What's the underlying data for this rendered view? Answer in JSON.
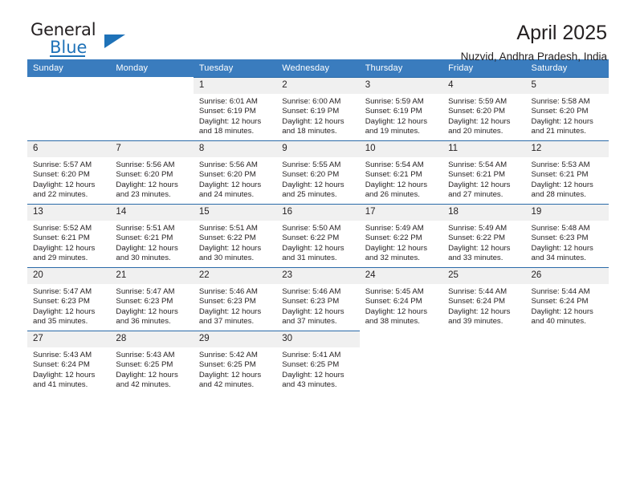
{
  "logo": {
    "primary_text": "General",
    "secondary_text": "Blue",
    "accent_color": "#1f72b8"
  },
  "header": {
    "title": "April 2025",
    "subtitle": "Nuzvid, Andhra Pradesh, India"
  },
  "calendar": {
    "header_color": "#3a7cbe",
    "weekday_headers": [
      "Sunday",
      "Monday",
      "Tuesday",
      "Wednesday",
      "Thursday",
      "Friday",
      "Saturday"
    ],
    "weeks": [
      [
        {
          "day": "",
          "sunrise": "",
          "sunset": "",
          "daylight_line1": "",
          "daylight_line2": ""
        },
        {
          "day": "",
          "sunrise": "",
          "sunset": "",
          "daylight_line1": "",
          "daylight_line2": ""
        },
        {
          "day": "1",
          "sunrise": "Sunrise: 6:01 AM",
          "sunset": "Sunset: 6:19 PM",
          "daylight_line1": "Daylight: 12 hours",
          "daylight_line2": "and 18 minutes."
        },
        {
          "day": "2",
          "sunrise": "Sunrise: 6:00 AM",
          "sunset": "Sunset: 6:19 PM",
          "daylight_line1": "Daylight: 12 hours",
          "daylight_line2": "and 18 minutes."
        },
        {
          "day": "3",
          "sunrise": "Sunrise: 5:59 AM",
          "sunset": "Sunset: 6:19 PM",
          "daylight_line1": "Daylight: 12 hours",
          "daylight_line2": "and 19 minutes."
        },
        {
          "day": "4",
          "sunrise": "Sunrise: 5:59 AM",
          "sunset": "Sunset: 6:20 PM",
          "daylight_line1": "Daylight: 12 hours",
          "daylight_line2": "and 20 minutes."
        },
        {
          "day": "5",
          "sunrise": "Sunrise: 5:58 AM",
          "sunset": "Sunset: 6:20 PM",
          "daylight_line1": "Daylight: 12 hours",
          "daylight_line2": "and 21 minutes."
        }
      ],
      [
        {
          "day": "6",
          "sunrise": "Sunrise: 5:57 AM",
          "sunset": "Sunset: 6:20 PM",
          "daylight_line1": "Daylight: 12 hours",
          "daylight_line2": "and 22 minutes."
        },
        {
          "day": "7",
          "sunrise": "Sunrise: 5:56 AM",
          "sunset": "Sunset: 6:20 PM",
          "daylight_line1": "Daylight: 12 hours",
          "daylight_line2": "and 23 minutes."
        },
        {
          "day": "8",
          "sunrise": "Sunrise: 5:56 AM",
          "sunset": "Sunset: 6:20 PM",
          "daylight_line1": "Daylight: 12 hours",
          "daylight_line2": "and 24 minutes."
        },
        {
          "day": "9",
          "sunrise": "Sunrise: 5:55 AM",
          "sunset": "Sunset: 6:20 PM",
          "daylight_line1": "Daylight: 12 hours",
          "daylight_line2": "and 25 minutes."
        },
        {
          "day": "10",
          "sunrise": "Sunrise: 5:54 AM",
          "sunset": "Sunset: 6:21 PM",
          "daylight_line1": "Daylight: 12 hours",
          "daylight_line2": "and 26 minutes."
        },
        {
          "day": "11",
          "sunrise": "Sunrise: 5:54 AM",
          "sunset": "Sunset: 6:21 PM",
          "daylight_line1": "Daylight: 12 hours",
          "daylight_line2": "and 27 minutes."
        },
        {
          "day": "12",
          "sunrise": "Sunrise: 5:53 AM",
          "sunset": "Sunset: 6:21 PM",
          "daylight_line1": "Daylight: 12 hours",
          "daylight_line2": "and 28 minutes."
        }
      ],
      [
        {
          "day": "13",
          "sunrise": "Sunrise: 5:52 AM",
          "sunset": "Sunset: 6:21 PM",
          "daylight_line1": "Daylight: 12 hours",
          "daylight_line2": "and 29 minutes."
        },
        {
          "day": "14",
          "sunrise": "Sunrise: 5:51 AM",
          "sunset": "Sunset: 6:21 PM",
          "daylight_line1": "Daylight: 12 hours",
          "daylight_line2": "and 30 minutes."
        },
        {
          "day": "15",
          "sunrise": "Sunrise: 5:51 AM",
          "sunset": "Sunset: 6:22 PM",
          "daylight_line1": "Daylight: 12 hours",
          "daylight_line2": "and 30 minutes."
        },
        {
          "day": "16",
          "sunrise": "Sunrise: 5:50 AM",
          "sunset": "Sunset: 6:22 PM",
          "daylight_line1": "Daylight: 12 hours",
          "daylight_line2": "and 31 minutes."
        },
        {
          "day": "17",
          "sunrise": "Sunrise: 5:49 AM",
          "sunset": "Sunset: 6:22 PM",
          "daylight_line1": "Daylight: 12 hours",
          "daylight_line2": "and 32 minutes."
        },
        {
          "day": "18",
          "sunrise": "Sunrise: 5:49 AM",
          "sunset": "Sunset: 6:22 PM",
          "daylight_line1": "Daylight: 12 hours",
          "daylight_line2": "and 33 minutes."
        },
        {
          "day": "19",
          "sunrise": "Sunrise: 5:48 AM",
          "sunset": "Sunset: 6:23 PM",
          "daylight_line1": "Daylight: 12 hours",
          "daylight_line2": "and 34 minutes."
        }
      ],
      [
        {
          "day": "20",
          "sunrise": "Sunrise: 5:47 AM",
          "sunset": "Sunset: 6:23 PM",
          "daylight_line1": "Daylight: 12 hours",
          "daylight_line2": "and 35 minutes."
        },
        {
          "day": "21",
          "sunrise": "Sunrise: 5:47 AM",
          "sunset": "Sunset: 6:23 PM",
          "daylight_line1": "Daylight: 12 hours",
          "daylight_line2": "and 36 minutes."
        },
        {
          "day": "22",
          "sunrise": "Sunrise: 5:46 AM",
          "sunset": "Sunset: 6:23 PM",
          "daylight_line1": "Daylight: 12 hours",
          "daylight_line2": "and 37 minutes."
        },
        {
          "day": "23",
          "sunrise": "Sunrise: 5:46 AM",
          "sunset": "Sunset: 6:23 PM",
          "daylight_line1": "Daylight: 12 hours",
          "daylight_line2": "and 37 minutes."
        },
        {
          "day": "24",
          "sunrise": "Sunrise: 5:45 AM",
          "sunset": "Sunset: 6:24 PM",
          "daylight_line1": "Daylight: 12 hours",
          "daylight_line2": "and 38 minutes."
        },
        {
          "day": "25",
          "sunrise": "Sunrise: 5:44 AM",
          "sunset": "Sunset: 6:24 PM",
          "daylight_line1": "Daylight: 12 hours",
          "daylight_line2": "and 39 minutes."
        },
        {
          "day": "26",
          "sunrise": "Sunrise: 5:44 AM",
          "sunset": "Sunset: 6:24 PM",
          "daylight_line1": "Daylight: 12 hours",
          "daylight_line2": "and 40 minutes."
        }
      ],
      [
        {
          "day": "27",
          "sunrise": "Sunrise: 5:43 AM",
          "sunset": "Sunset: 6:24 PM",
          "daylight_line1": "Daylight: 12 hours",
          "daylight_line2": "and 41 minutes."
        },
        {
          "day": "28",
          "sunrise": "Sunrise: 5:43 AM",
          "sunset": "Sunset: 6:25 PM",
          "daylight_line1": "Daylight: 12 hours",
          "daylight_line2": "and 42 minutes."
        },
        {
          "day": "29",
          "sunrise": "Sunrise: 5:42 AM",
          "sunset": "Sunset: 6:25 PM",
          "daylight_line1": "Daylight: 12 hours",
          "daylight_line2": "and 42 minutes."
        },
        {
          "day": "30",
          "sunrise": "Sunrise: 5:41 AM",
          "sunset": "Sunset: 6:25 PM",
          "daylight_line1": "Daylight: 12 hours",
          "daylight_line2": "and 43 minutes."
        },
        {
          "day": "",
          "sunrise": "",
          "sunset": "",
          "daylight_line1": "",
          "daylight_line2": ""
        },
        {
          "day": "",
          "sunrise": "",
          "sunset": "",
          "daylight_line1": "",
          "daylight_line2": ""
        },
        {
          "day": "",
          "sunrise": "",
          "sunset": "",
          "daylight_line1": "",
          "daylight_line2": ""
        }
      ]
    ]
  }
}
